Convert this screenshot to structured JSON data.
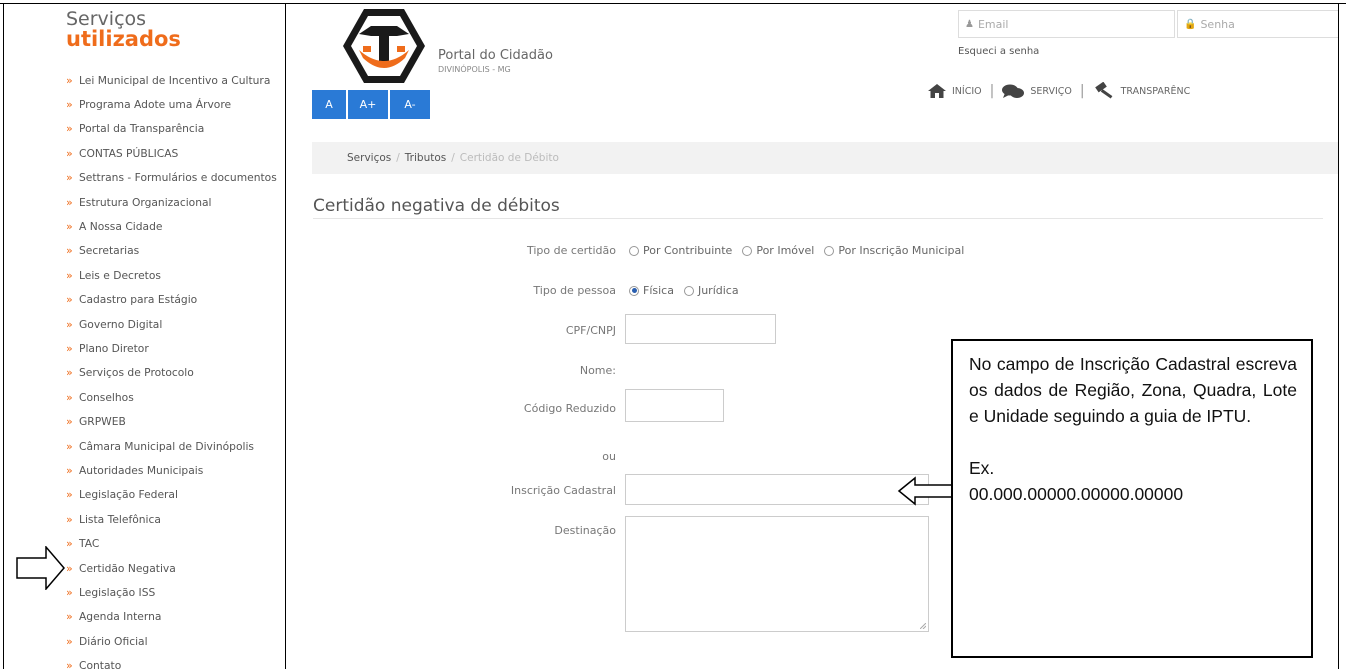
{
  "sidebar": {
    "title_line1": "Serviços",
    "title_line2": "utilizados",
    "items": [
      "Lei Municipal de Incentivo a Cultura",
      "Programa Adote uma Árvore",
      "Portal da Transparência",
      "CONTAS PÚBLICAS",
      "Settrans - Formulários e documentos",
      "Estrutura Organizacional",
      "A Nossa Cidade",
      "Secretarias",
      "Leis e Decretos",
      "Cadastro para Estágio",
      "Governo Digital",
      "Plano Diretor",
      "Serviços de Protocolo",
      "Conselhos",
      "GRPWEB",
      "Câmara Municipal de Divinópolis",
      "Autoridades Municipais",
      "Legislação Federal",
      "Lista Telefônica",
      "TAC",
      "Certidão Negativa",
      "Legislação ISS",
      "Agenda Interna",
      "Diário Oficial",
      "Contato"
    ]
  },
  "header": {
    "portal_name": "Portal do Cidadão",
    "portal_sub": "DIVINÓPOLIS - MG",
    "font_buttons": [
      "A",
      "A+",
      "A-"
    ],
    "login": {
      "email_placeholder": "Email",
      "password_placeholder": "Senha",
      "forgot": "Esqueci a senha"
    },
    "nav": [
      "INÍCIO",
      "SERVIÇO",
      "TRANSPARÊNC"
    ]
  },
  "breadcrumb": {
    "items": [
      "Serviços",
      "Tributos"
    ],
    "current": "Certidão de Débito"
  },
  "form": {
    "title": "Certidão negativa de débitos",
    "tipo_certidao_label": "Tipo de certidão",
    "tipo_certidao_options": [
      "Por Contribuinte",
      "Por Imóvel",
      "Por Inscrição Municipal"
    ],
    "tipo_pessoa_label": "Tipo de pessoa",
    "tipo_pessoa_options": [
      "Física",
      "Jurídica"
    ],
    "tipo_pessoa_selected": "Física",
    "cpf_label": "CPF/CNPJ",
    "nome_label": "Nome:",
    "codigo_label": "Código Reduzido",
    "ou_label": "ou",
    "inscricao_label": "Inscrição Cadastral",
    "destinacao_label": "Destinação"
  },
  "callout": {
    "text": "No campo de Inscrição Cadastral escreva os dados de Região, Zona, Quadra, Lote e Unidade seguindo a guia de IPTU.",
    "example_label": "Ex.",
    "example_value": "00.000.00000.00000.00000"
  },
  "colors": {
    "accent_orange": "#ef6c1b",
    "button_blue": "#2a7ad6"
  }
}
